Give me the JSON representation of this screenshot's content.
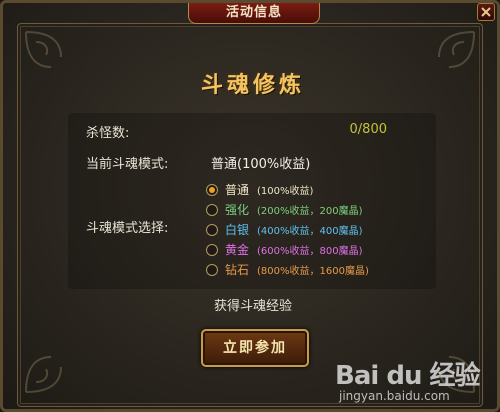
{
  "window": {
    "title": "活动信息"
  },
  "dialog": {
    "heading": "斗魂修炼",
    "kills_label": "杀怪数:",
    "kills_value": "0/800",
    "current_mode_label": "当前斗魂模式:",
    "current_mode_value": "普通(100%收益)",
    "mode_select_label": "斗魂模式选择:",
    "options": [
      {
        "name": "普通",
        "desc": "(100%收益)",
        "color": "#f0e6c8",
        "checked": true
      },
      {
        "name": "强化",
        "desc": "(200%收益，200魔晶)",
        "color": "#7ed07e",
        "checked": false
      },
      {
        "name": "白银",
        "desc": "(400%收益，400魔晶)",
        "color": "#5ec0f0",
        "checked": false
      },
      {
        "name": "黄金",
        "desc": "(600%收益，800魔晶)",
        "color": "#e070e8",
        "checked": false
      },
      {
        "name": "钻石",
        "desc": "(800%收益，1600魔晶)",
        "color": "#e89a4a",
        "checked": false
      }
    ],
    "gain_text": "获得斗魂经验",
    "join_button": "立即参加"
  },
  "watermark": {
    "logo": "Bai du 经验",
    "url": "jingyan.baidu.com"
  }
}
